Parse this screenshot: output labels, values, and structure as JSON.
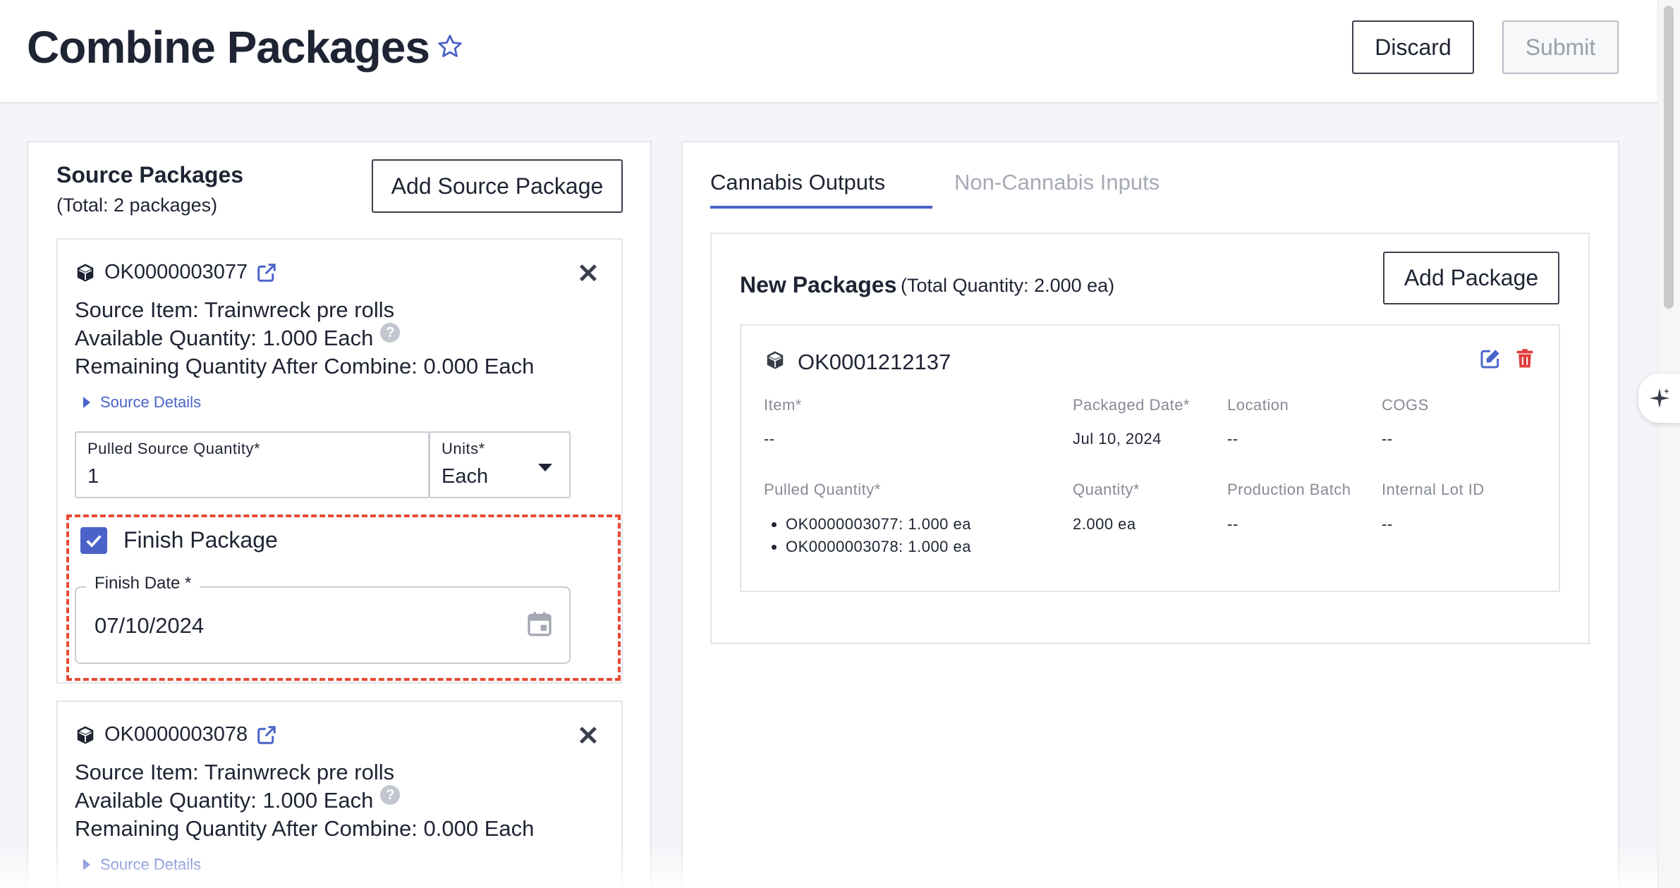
{
  "header": {
    "title": "Combine Packages",
    "discard_label": "Discard",
    "submit_label": "Submit"
  },
  "source": {
    "title": "Source Packages",
    "total": "(Total: 2 packages)",
    "add_label": "Add Source Package",
    "packages": [
      {
        "id": "OK0000003077",
        "source_item": "Source Item:  Trainwreck pre rolls",
        "available": "Available Quantity:  1.000 Each",
        "remaining": "Remaining Quantity After Combine:  0.000 Each",
        "details_label": "Source Details",
        "pulled_label": "Pulled Source Quantity*",
        "pulled_value": "1",
        "units_label": "Units*",
        "units_value": "Each",
        "finish_label": "Finish Package",
        "finish_checked": true,
        "finish_date_label": "Finish Date *",
        "finish_date_value": "07/10/2024"
      },
      {
        "id": "OK0000003078",
        "source_item": "Source Item:  Trainwreck pre rolls",
        "available": "Available Quantity:  1.000 Each",
        "remaining": "Remaining Quantity After Combine:  0.000 Each",
        "details_label": "Source Details"
      }
    ]
  },
  "outputs": {
    "tabs": [
      {
        "label": "Cannabis Outputs",
        "active": true
      },
      {
        "label": "Non-Cannabis Inputs",
        "active": false
      }
    ],
    "title": "New Packages",
    "total": "(Total Quantity: 2.000 ea)",
    "add_label": "Add Package",
    "package": {
      "id": "OK0001212137",
      "fields": {
        "item_label": "Item*",
        "item_value": "--",
        "packaged_date_label": "Packaged Date*",
        "packaged_date_value": "Jul 10, 2024",
        "location_label": "Location",
        "location_value": "--",
        "cogs_label": "COGS",
        "cogs_value": "--",
        "pulled_label": "Pulled Quantity*",
        "pulled_values": [
          "OK0000003077: 1.000 ea",
          "OK0000003078: 1.000 ea"
        ],
        "quantity_label": "Quantity*",
        "quantity_value": "2.000 ea",
        "batch_label": "Production Batch",
        "batch_value": "--",
        "lot_label": "Internal Lot ID",
        "lot_value": "--"
      }
    }
  },
  "colors": {
    "accent": "#4b63c9",
    "danger": "#e03c3c",
    "highlight_dashed": "#e74a33"
  }
}
